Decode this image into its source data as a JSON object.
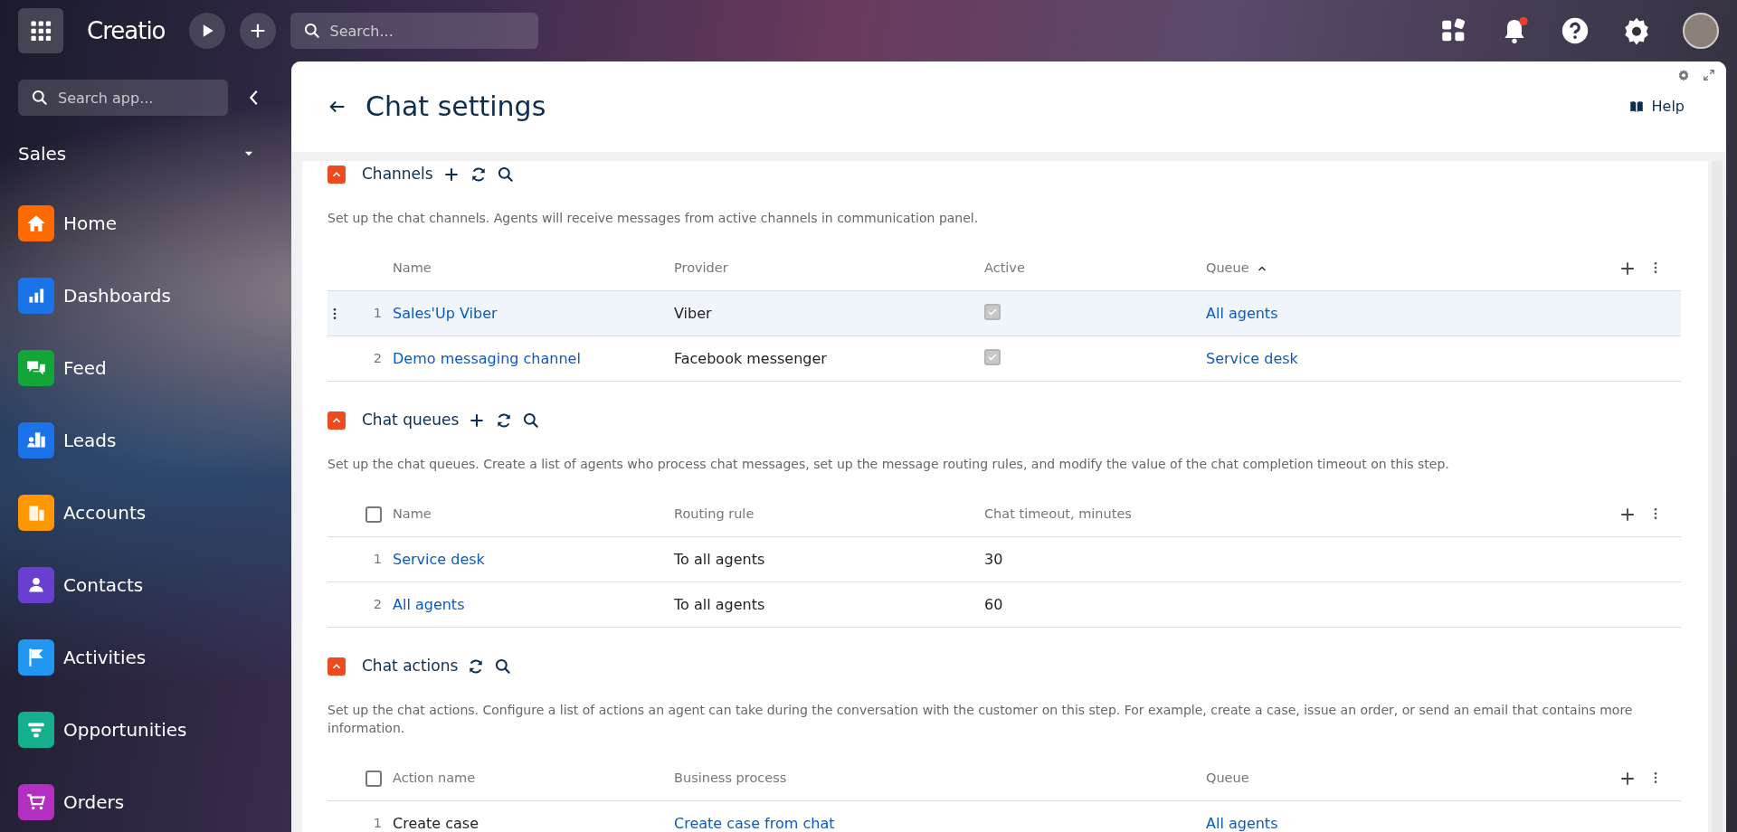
{
  "topbar": {
    "brand": "Creatio",
    "search": {
      "placeholder": "Search..."
    },
    "notifications": {
      "unread": true
    }
  },
  "sidebar": {
    "search": {
      "placeholder": "Search app..."
    },
    "workplace": "Sales",
    "items": [
      {
        "label": "Home",
        "color": "#ff6a00"
      },
      {
        "label": "Dashboards",
        "color": "#1a73e8"
      },
      {
        "label": "Feed",
        "color": "#13a538"
      },
      {
        "label": "Leads",
        "color": "#1a73e8"
      },
      {
        "label": "Accounts",
        "color": "#ff9800"
      },
      {
        "label": "Contacts",
        "color": "#6a3fd0"
      },
      {
        "label": "Activities",
        "color": "#2196f3"
      },
      {
        "label": "Opportunities",
        "color": "#14b08e"
      },
      {
        "label": "Orders",
        "color": "#b32fc2"
      }
    ]
  },
  "page": {
    "title": "Chat settings",
    "help": "Help"
  },
  "sections": [
    {
      "title": "Channels",
      "expanded": true,
      "can_add": true,
      "description": "Set up the chat channels. Agents will receive messages from active channels in communication panel.",
      "columns": [
        {
          "label": "Name"
        },
        {
          "label": "Provider"
        },
        {
          "label": "Active"
        },
        {
          "label": "Queue",
          "sorted": true
        }
      ],
      "rows": [
        {
          "number": "1",
          "selected": true,
          "cells": [
            {
              "kind": "link",
              "text": "Sales'Up Viber"
            },
            {
              "kind": "text",
              "text": "Viber"
            },
            {
              "kind": "checkbox",
              "checked": true
            },
            {
              "kind": "link",
              "text": "All agents"
            }
          ]
        },
        {
          "number": "2",
          "selected": false,
          "cells": [
            {
              "kind": "link",
              "text": "Demo messaging channel"
            },
            {
              "kind": "text",
              "text": "Facebook messenger"
            },
            {
              "kind": "checkbox",
              "checked": true
            },
            {
              "kind": "link",
              "text": "Service desk"
            }
          ]
        }
      ]
    },
    {
      "title": "Chat queues",
      "expanded": true,
      "can_add": true,
      "description": "Set up the chat queues. Create a list of agents who process chat messages, set up the message routing rules, and modify the value of the chat completion timeout on this step.",
      "select_all": {
        "checked": false
      },
      "columns": [
        {
          "label": "Name"
        },
        {
          "label": "Routing rule"
        },
        {
          "label": "Chat timeout, minutes"
        }
      ],
      "rows": [
        {
          "number": "1",
          "selected": false,
          "cells": [
            {
              "kind": "link",
              "text": "Service desk"
            },
            {
              "kind": "text",
              "text": "To all agents"
            },
            {
              "kind": "text",
              "text": "30"
            }
          ]
        },
        {
          "number": "2",
          "selected": false,
          "cells": [
            {
              "kind": "link",
              "text": "All agents"
            },
            {
              "kind": "text",
              "text": "To all agents"
            },
            {
              "kind": "text",
              "text": "60"
            }
          ]
        }
      ]
    },
    {
      "title": "Chat actions",
      "expanded": true,
      "description": "Set up the chat actions. Configure a list of actions an agent can take during the conversation with the customer on this step. For example, create a case, issue an order, or send an email that contains more information.",
      "select_all": {
        "checked": false
      },
      "columns": [
        {
          "label": "Action name"
        },
        {
          "label": "Business process"
        },
        {
          "label": "Queue"
        }
      ],
      "rows": [
        {
          "number": "1",
          "selected": false,
          "cells": [
            {
              "kind": "text",
              "text": "Create case"
            },
            {
              "kind": "link",
              "text": "Create case from chat"
            },
            {
              "kind": "link",
              "text": "All agents"
            }
          ]
        }
      ]
    }
  ]
}
